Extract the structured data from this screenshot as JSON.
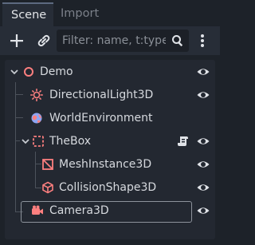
{
  "tabs": {
    "scene": "Scene",
    "import": "Import"
  },
  "toolbar": {
    "filter_placeholder": "Filter: name, t:type, g:group"
  },
  "icons": {
    "add": "plus-icon",
    "instance": "chain-link-icon",
    "search": "magnifier-icon",
    "menu": "kebab-menu-icon",
    "visibility": "eye-icon",
    "script": "script-icon",
    "expand": "chevron-down-icon"
  },
  "colors": {
    "background": "#1d2229",
    "panel": "#272d37",
    "tree": "#232831",
    "node3d": "#fc7f7f",
    "environment": "#8da5f3",
    "text": "#d6d9de"
  },
  "tree": {
    "nodes": [
      {
        "name": "Demo",
        "type": "Node3D"
      },
      {
        "name": "DirectionalLight3D",
        "type": "DirectionalLight3D"
      },
      {
        "name": "WorldEnvironment",
        "type": "WorldEnvironment"
      },
      {
        "name": "TheBox",
        "type": "Area3D"
      },
      {
        "name": "MeshInstance3D",
        "type": "MeshInstance3D"
      },
      {
        "name": "CollisionShape3D",
        "type": "CollisionShape3D"
      },
      {
        "name": "Camera3D",
        "type": "Camera3D"
      }
    ]
  }
}
